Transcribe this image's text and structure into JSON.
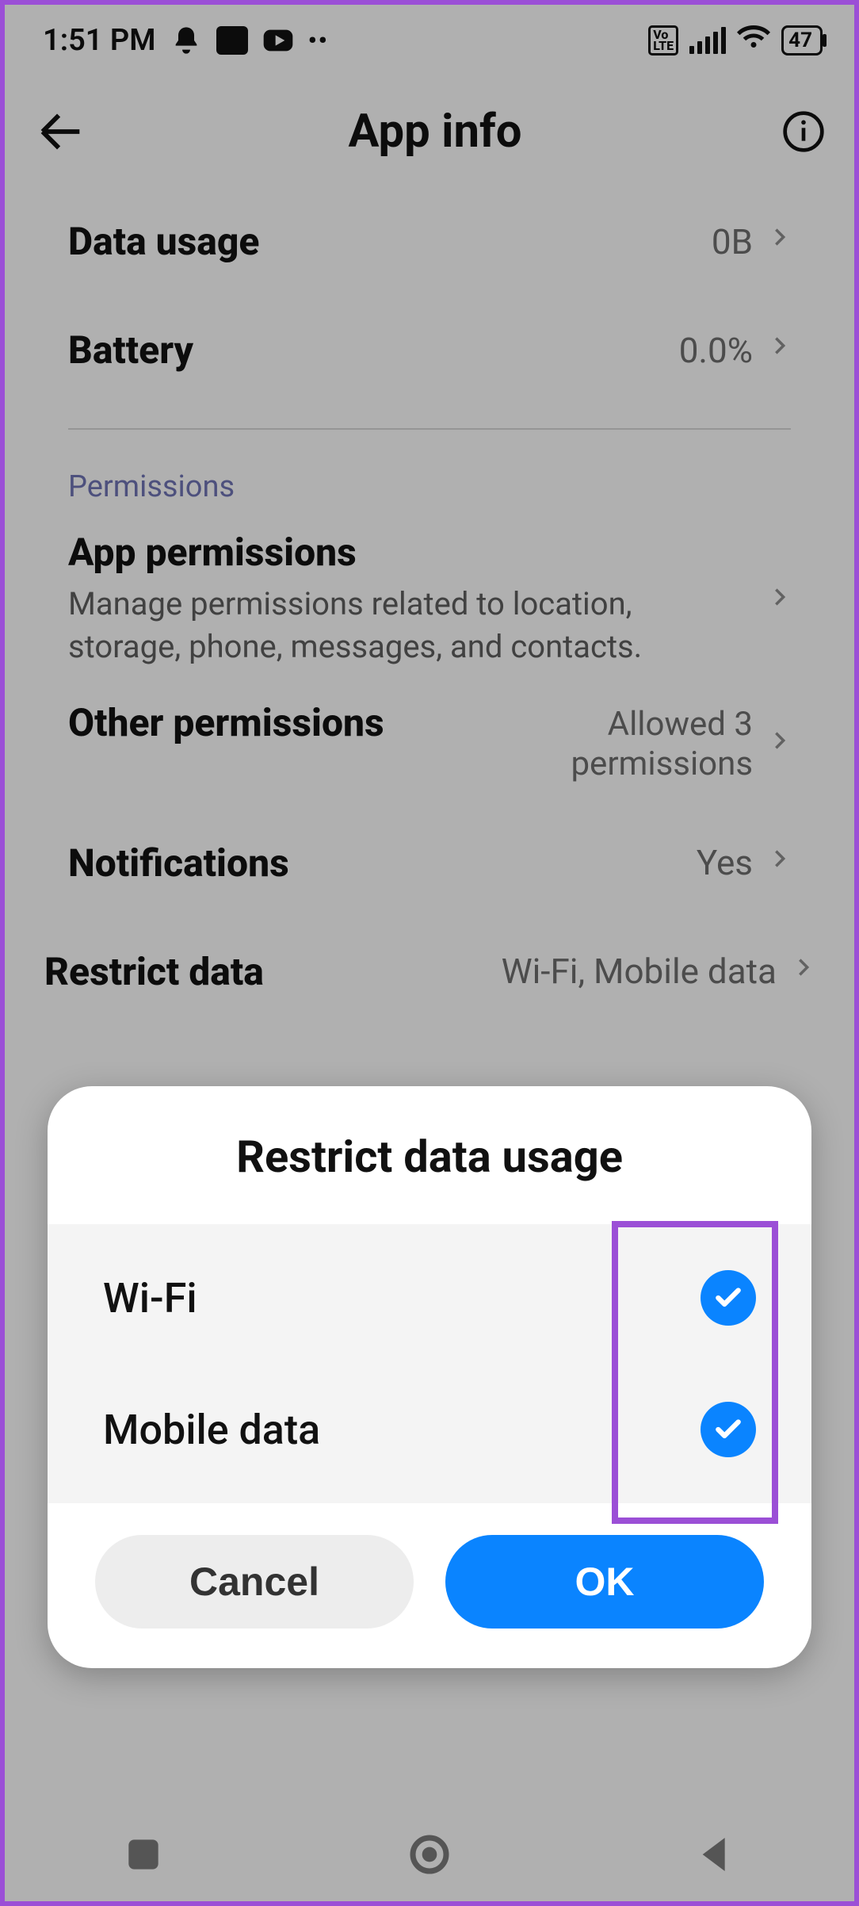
{
  "statusbar": {
    "time": "1:51 PM",
    "battery": "47"
  },
  "header": {
    "title": "App info"
  },
  "rows": {
    "data_usage": {
      "label": "Data usage",
      "value": "0B"
    },
    "battery": {
      "label": "Battery",
      "value": "0.0%"
    }
  },
  "section": {
    "permissions_label": "Permissions"
  },
  "perms": {
    "app": {
      "title": "App permissions",
      "desc": "Manage permissions related to location, storage, phone, messages, and contacts."
    },
    "other": {
      "title": "Other permissions",
      "value1": "Allowed 3",
      "value2": "permissions"
    },
    "notifications": {
      "title": "Notifications",
      "value": "Yes"
    },
    "restrict": {
      "title": "Restrict data",
      "value": "Wi-Fi, Mobile data"
    }
  },
  "dialog": {
    "title": "Restrict data usage",
    "options": {
      "wifi": {
        "label": "Wi-Fi",
        "checked": true
      },
      "mobile": {
        "label": "Mobile data",
        "checked": true
      }
    },
    "cancel": "Cancel",
    "ok": "OK"
  }
}
